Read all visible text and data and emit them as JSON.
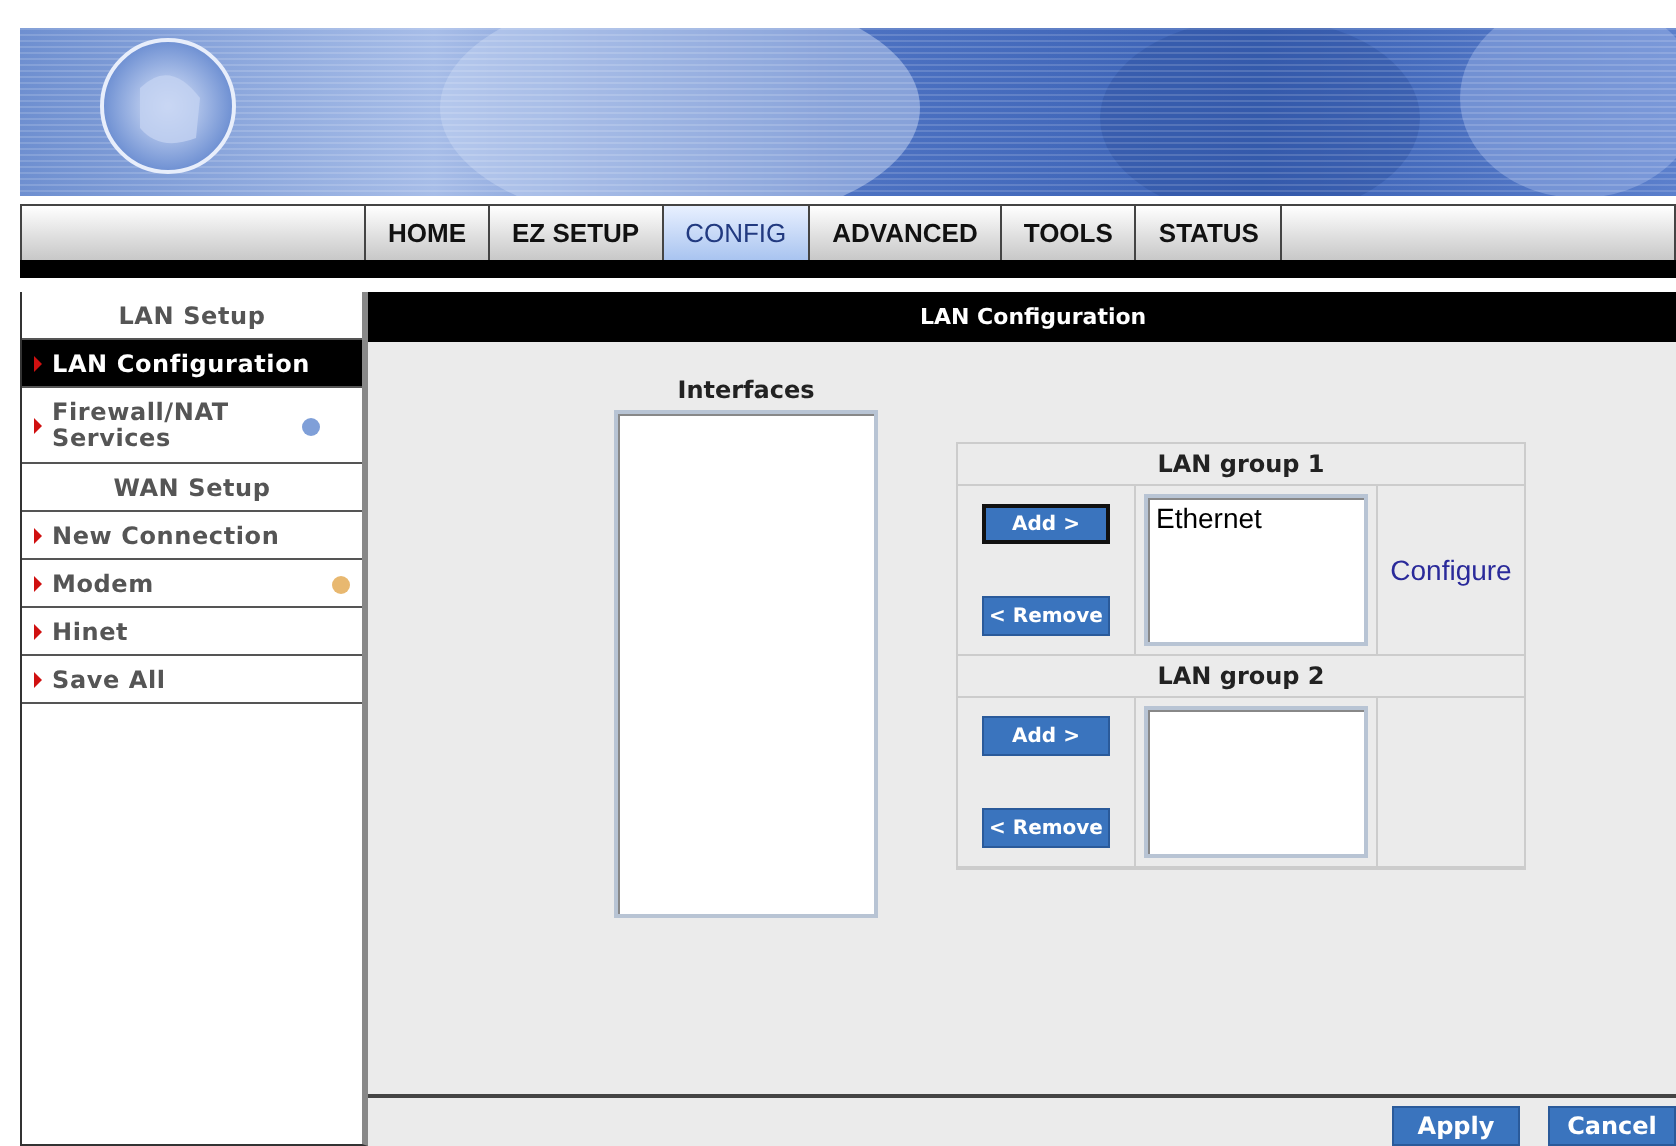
{
  "nav": {
    "tabs": [
      {
        "label": "HOME",
        "selected": false
      },
      {
        "label": "EZ SETUP",
        "selected": false
      },
      {
        "label": "CONFIG",
        "selected": true
      },
      {
        "label": "ADVANCED",
        "selected": false
      },
      {
        "label": "TOOLS",
        "selected": false
      },
      {
        "label": "STATUS",
        "selected": false
      }
    ]
  },
  "sidebar": {
    "items": [
      {
        "kind": "header",
        "label": "LAN Setup"
      },
      {
        "kind": "link",
        "label": "LAN Configuration",
        "selected": true
      },
      {
        "kind": "link",
        "label": "Firewall/NAT Services",
        "selected": false,
        "color": "#7f9fd8"
      },
      {
        "kind": "header",
        "label": "WAN Setup"
      },
      {
        "kind": "link",
        "label": "New Connection",
        "selected": false
      },
      {
        "kind": "link",
        "label": "Modem",
        "selected": false,
        "color": "#e8b870"
      },
      {
        "kind": "link",
        "label": "Hinet",
        "selected": false
      },
      {
        "kind": "link",
        "label": "Save All",
        "selected": false
      }
    ]
  },
  "main": {
    "title": "LAN Configuration",
    "interfaces": {
      "label": "Interfaces"
    },
    "groups": [
      {
        "title": "LAN group 1",
        "add": "Add >",
        "remove": "< Remove",
        "items": [
          "Ethernet"
        ],
        "link": "Configure"
      },
      {
        "title": "LAN group 2",
        "add": "Add >",
        "remove": "< Remove"
      }
    ],
    "buttons": [
      "Apply",
      "Cancel"
    ]
  }
}
